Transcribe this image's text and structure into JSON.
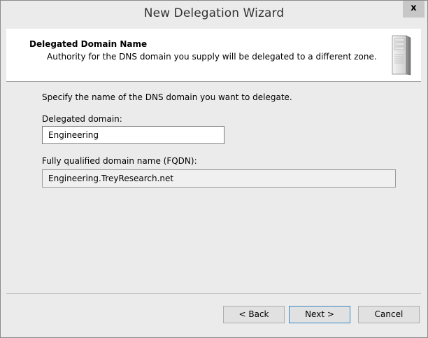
{
  "window": {
    "title": "New Delegation Wizard",
    "close_glyph": "x"
  },
  "header": {
    "title": "Delegated Domain Name",
    "subtitle": "Authority for the DNS domain you supply will be delegated to a different zone.",
    "icon": "server-tower-icon"
  },
  "form": {
    "instruction": "Specify the name of the DNS domain you want to delegate.",
    "delegated_domain_label": "Delegated domain:",
    "delegated_domain_value": "Engineering",
    "fqdn_label": "Fully qualified domain name (FQDN):",
    "fqdn_value": "Engineering.TreyResearch.net"
  },
  "buttons": {
    "back": "< Back",
    "next": "Next >",
    "cancel": "Cancel"
  }
}
